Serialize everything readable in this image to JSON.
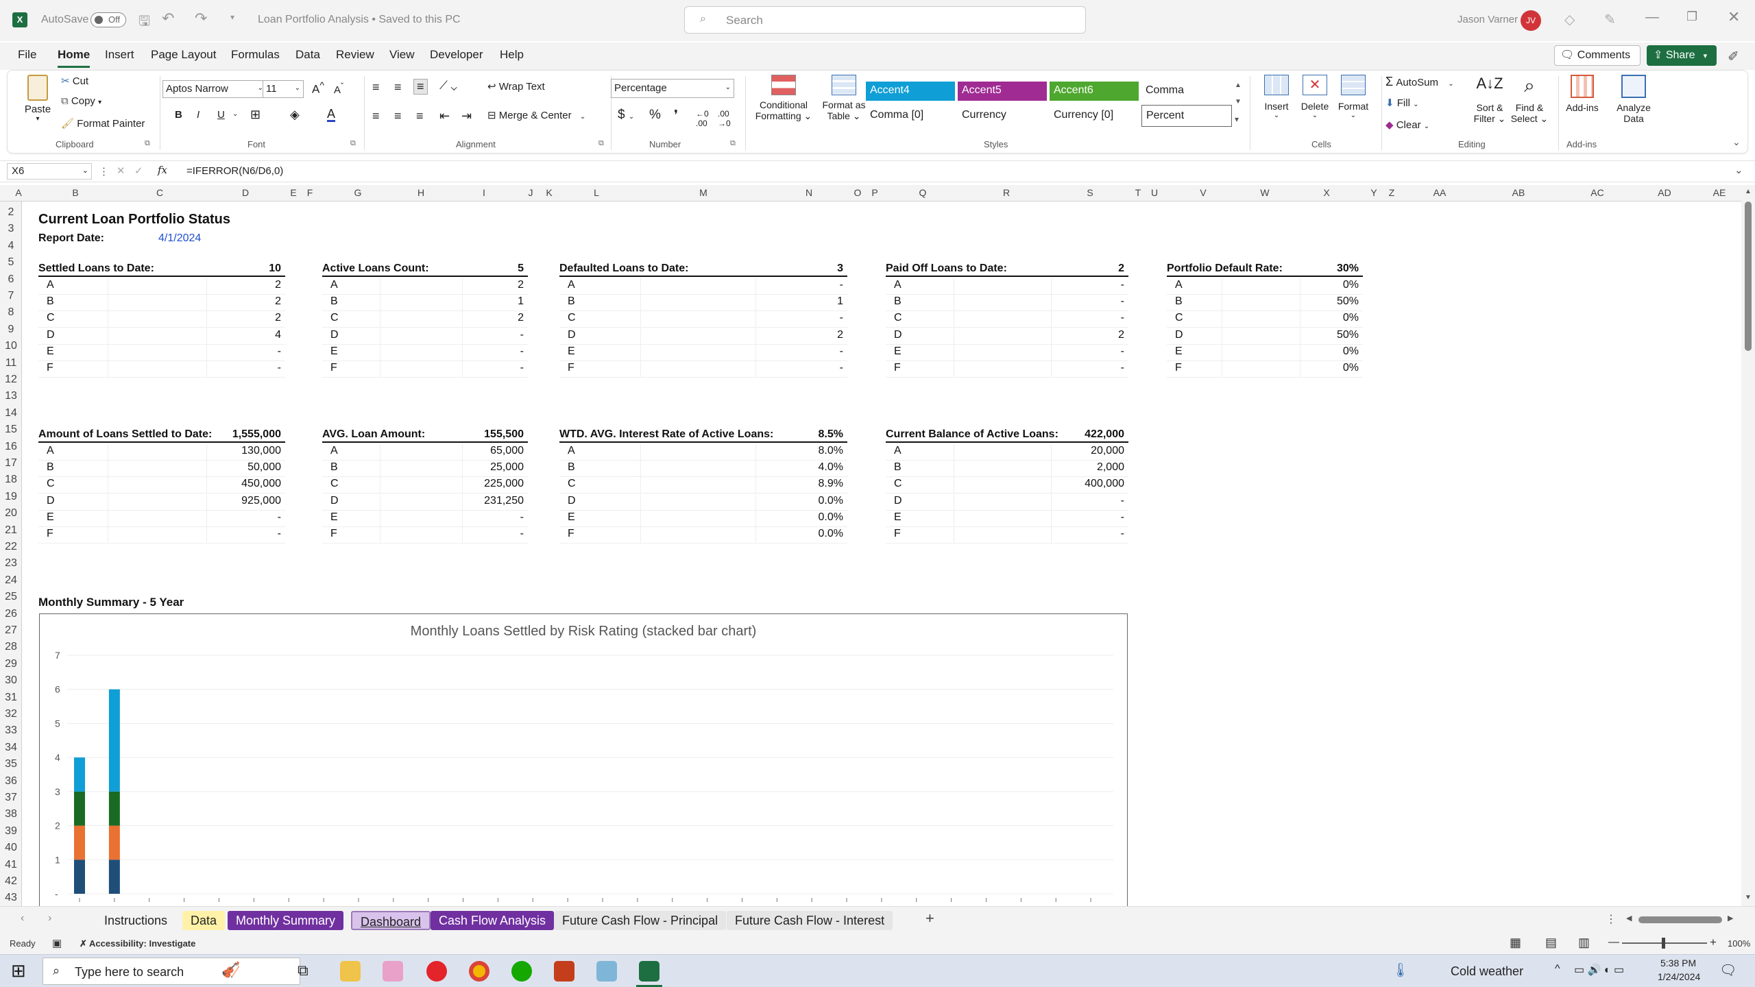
{
  "title_bar": {
    "autosave_label": "AutoSave",
    "autosave_state": "Off",
    "doc_title": "Loan Portfolio Analysis • Saved to this PC",
    "search_placeholder": "Search",
    "user_name": "Jason Varner",
    "user_initials": "JV"
  },
  "menu_tabs": [
    "File",
    "Home",
    "Insert",
    "Page Layout",
    "Formulas",
    "Data",
    "Review",
    "View",
    "Developer",
    "Help"
  ],
  "active_tab": "Home",
  "comments_label": "Comments",
  "share_label": "Share",
  "ribbon": {
    "clipboard": {
      "paste": "Paste",
      "cut": "Cut",
      "copy": "Copy",
      "format_painter": "Format Painter",
      "group": "Clipboard"
    },
    "font": {
      "name": "Aptos Narrow",
      "size": "11",
      "group": "Font"
    },
    "alignment": {
      "wrap_text": "Wrap Text",
      "merge_center": "Merge & Center",
      "group": "Alignment"
    },
    "number": {
      "format": "Percentage",
      "group": "Number"
    },
    "styles": {
      "conditional": "Conditional",
      "conditional2": "Formatting",
      "format_as": "Format as",
      "format_as2": "Table",
      "group": "Styles",
      "cells": [
        "Accent4",
        "Accent5",
        "Accent6",
        "Comma",
        "Comma [0]",
        "Currency",
        "Currency [0]",
        "Percent"
      ]
    },
    "cells": {
      "insert": "Insert",
      "delete": "Delete",
      "format": "Format",
      "group": "Cells"
    },
    "editing": {
      "autosum": "AutoSum",
      "fill": "Fill",
      "clear": "Clear",
      "sort": "Sort &",
      "sort2": "Filter",
      "find": "Find &",
      "find2": "Select",
      "group": "Editing"
    },
    "addins": {
      "addins": "Add-ins",
      "analyze": "Analyze",
      "analyze2": "Data",
      "group": "Add-ins"
    }
  },
  "formula_bar": {
    "name_box": "X6",
    "formula": "=IFERROR(N6/D6,0)",
    "fx": "fx"
  },
  "columns": [
    "A",
    "B",
    "C",
    "D",
    "E",
    "F",
    "G",
    "H",
    "I",
    "J",
    "K",
    "L",
    "M",
    "N",
    "O",
    "P",
    "Q",
    "R",
    "S",
    "T",
    "U",
    "V",
    "W",
    "X",
    "Y",
    "Z",
    "AA",
    "AB",
    "AC",
    "AD",
    "AE"
  ],
  "rows": [
    "2",
    "3",
    "4",
    "5",
    "6",
    "7",
    "8",
    "9",
    "10",
    "11",
    "12",
    "13",
    "14",
    "15",
    "16",
    "17",
    "18",
    "19",
    "20",
    "21",
    "22",
    "23",
    "24",
    "25",
    "26",
    "27",
    "28",
    "29",
    "30",
    "31",
    "32",
    "33",
    "34",
    "35",
    "36",
    "37",
    "38",
    "39",
    "40",
    "41",
    "42",
    "43"
  ],
  "sheet": {
    "title": "Current Loan Portfolio Status",
    "report_date_label": "Report Date:",
    "report_date": "4/1/2024",
    "ratings": [
      "A",
      "B",
      "C",
      "D",
      "E",
      "F"
    ],
    "blocks_top": [
      {
        "label": "Settled Loans to Date:",
        "total": "10",
        "values": [
          "2",
          "2",
          "2",
          "4",
          "-",
          "-"
        ]
      },
      {
        "label": "Active Loans Count:",
        "total": "5",
        "values": [
          "2",
          "1",
          "2",
          "-",
          "-",
          "-"
        ]
      },
      {
        "label": "Defaulted Loans to Date:",
        "total": "3",
        "values": [
          "-",
          "1",
          "-",
          "2",
          "-",
          "-"
        ]
      },
      {
        "label": "Paid Off Loans to Date:",
        "total": "2",
        "values": [
          "-",
          "-",
          "-",
          "2",
          "-",
          "-"
        ]
      },
      {
        "label": "Portfolio Default Rate:",
        "total": "30%",
        "values": [
          "0%",
          "50%",
          "0%",
          "50%",
          "0%",
          "0%"
        ]
      }
    ],
    "blocks_bottom": [
      {
        "label": "Amount of Loans Settled to Date:",
        "total": "1,555,000",
        "values": [
          "130,000",
          "50,000",
          "450,000",
          "925,000",
          "-",
          "-"
        ]
      },
      {
        "label": "AVG. Loan Amount:",
        "total": "155,500",
        "values": [
          "65,000",
          "25,000",
          "225,000",
          "231,250",
          "-",
          "-"
        ]
      },
      {
        "label": "WTD. AVG. Interest Rate of Active Loans:",
        "total": "8.5%",
        "values": [
          "8.0%",
          "4.0%",
          "8.9%",
          "0.0%",
          "0.0%",
          "0.0%"
        ]
      },
      {
        "label": "Current Balance of Active Loans:",
        "total": "422,000",
        "values": [
          "20,000",
          "2,000",
          "400,000",
          "-",
          "-",
          "-"
        ]
      }
    ],
    "monthly_label": "Monthly Summary - 5 Year"
  },
  "chart_data": {
    "type": "bar",
    "stacked": true,
    "title": "Monthly Loans Settled by Risk Rating (stacked bar chart)",
    "ylim": [
      0,
      7
    ],
    "yticks": [
      "-",
      "1",
      "2",
      "3",
      "4",
      "5",
      "6",
      "7"
    ],
    "grid": true,
    "series": [
      {
        "values": [
          1,
          1
        ],
        "color": "#1f4e79"
      },
      {
        "values": [
          1,
          1
        ],
        "color": "#e97132"
      },
      {
        "values": [
          1,
          1
        ],
        "color": "#196b24"
      },
      {
        "values": [
          1,
          3
        ],
        "color": "#0f9ed5"
      }
    ],
    "bar_count": 30
  },
  "sheet_tabs": [
    {
      "label": "Instructions",
      "bg": "transparent",
      "fg": "#222"
    },
    {
      "label": "Data",
      "bg": "#fff2a8",
      "fg": "#222"
    },
    {
      "label": "Monthly Summary",
      "bg": "#7030a0",
      "fg": "#ffffff"
    },
    {
      "label": "Dashboard",
      "bg": "#d9c3ec",
      "fg": "#222",
      "active": true
    },
    {
      "label": "Cash Flow Analysis",
      "bg": "#7030a0",
      "fg": "#ffffff"
    },
    {
      "label": "Future Cash Flow - Principal",
      "bg": "#e6e6e6",
      "fg": "#222"
    },
    {
      "label": "Future Cash Flow - Interest",
      "bg": "#e6e6e6",
      "fg": "#222"
    }
  ],
  "status": {
    "ready": "Ready",
    "accessibility": "Accessibility: Investigate",
    "zoom": "100%"
  },
  "taskbar": {
    "search_placeholder": "Type here to search",
    "weather": "Cold weather",
    "time": "5:38 PM",
    "date": "1/24/2024"
  }
}
